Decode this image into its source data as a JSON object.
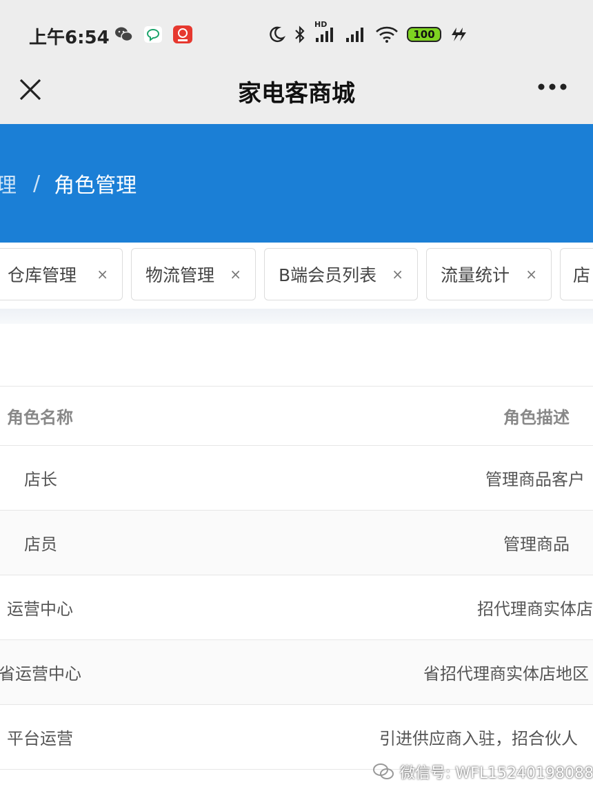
{
  "status_bar": {
    "time": "上午6:54",
    "hd_label": "HD",
    "battery": "100"
  },
  "titlebar": {
    "title": "家电客商城"
  },
  "breadcrumb": {
    "prev": "理",
    "separator": "/",
    "current": "角色管理"
  },
  "tabs": [
    {
      "label": "仓库管理",
      "close": "×"
    },
    {
      "label": "物流管理",
      "close": "×"
    },
    {
      "label": "B端会员列表",
      "close": "×"
    },
    {
      "label": "流量统计",
      "close": "×"
    },
    {
      "label": "店",
      "close": ""
    }
  ],
  "table": {
    "headers": {
      "name": "角色名称",
      "desc": "角色描述"
    },
    "rows": [
      {
        "name": "店长",
        "desc": "管理商品客户"
      },
      {
        "name": "店员",
        "desc": "管理商品"
      },
      {
        "name": "运营中心",
        "desc": "招代理商实体店"
      },
      {
        "name": "省运营中心",
        "desc": "省招代理商实体店地区"
      },
      {
        "name": "平台运营",
        "desc": "引进供应商入驻，招合伙人"
      }
    ]
  },
  "watermark": {
    "text": "微信号: WFL15240198088"
  },
  "colors": {
    "header_blue": "#1b7fd6",
    "battery_green": "#7ed321"
  }
}
